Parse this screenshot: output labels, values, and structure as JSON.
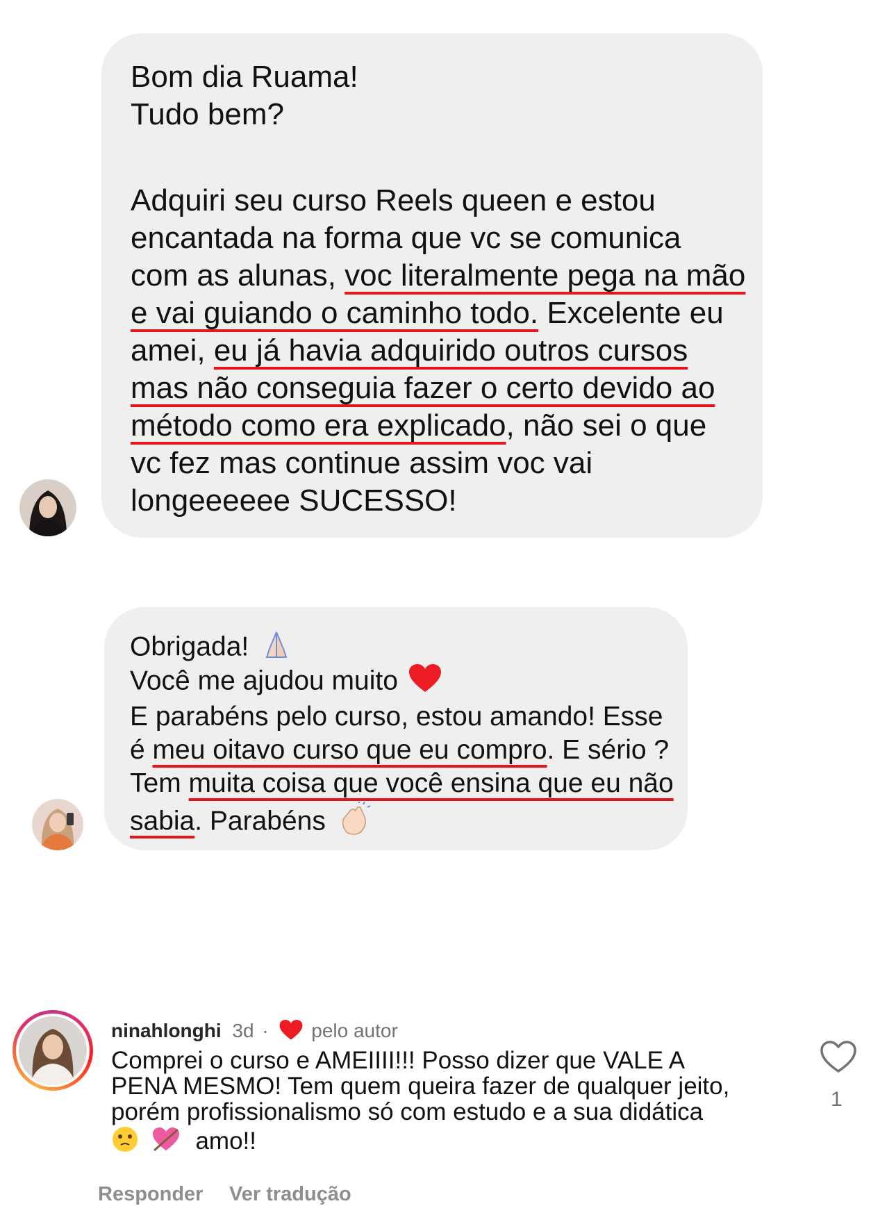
{
  "message1": {
    "lines": [
      "Bom dia Ruama!",
      "Tudo bem?",
      "Adquiri seu curso Reels queen e estou",
      "encantada na forma que vc se comunica",
      "com as alunas, ",
      "voc literalmente pega na mão",
      "e vai guiando o caminho todo.",
      " Excelente eu",
      "amei, ",
      "eu já havia adquirido outros cursos",
      "mas não conseguia fazer o certo devido ao",
      "método como era explicado",
      ", não sei o que",
      "vc fez mas continue assim voc vai",
      "longeeeeee SUCESSO!"
    ]
  },
  "message2": {
    "l1": "Obrigada!",
    "l2": "Você me ajudou muito",
    "l3": "E parabéns pelo curso, estou amando! Esse",
    "l4a": "é ",
    "l4b": "meu oitavo curso que eu compro",
    "l4c": ". E sério ?",
    "l5a": "Tem ",
    "l5b": "muita coisa que você ensina que eu não",
    "l6a": "sabia",
    "l6b": ". Parabéns",
    "emoji_pray": "pray-icon",
    "emoji_heart": "red-heart-icon",
    "emoji_clap": "clap-icon"
  },
  "comment": {
    "username": "ninahlonghi",
    "time": "3d",
    "separator": "·",
    "liked_by_author": "pelo autor",
    "text_lines": [
      "Comprei o curso e AMEIIII!!! Posso dizer que VALE A",
      "PENA MESMO! Tem quem queira fazer de qualquer jeito,",
      "porém profissionalismo só com estudo e a sua didática",
      "amo!!"
    ],
    "like_count": "1",
    "reply_label": "Responder",
    "translate_label": "Ver tradução"
  },
  "colors": {
    "bubble": "#efefef",
    "underline": "#e2161b",
    "heart": "#ed1c24",
    "muted": "#737373"
  }
}
